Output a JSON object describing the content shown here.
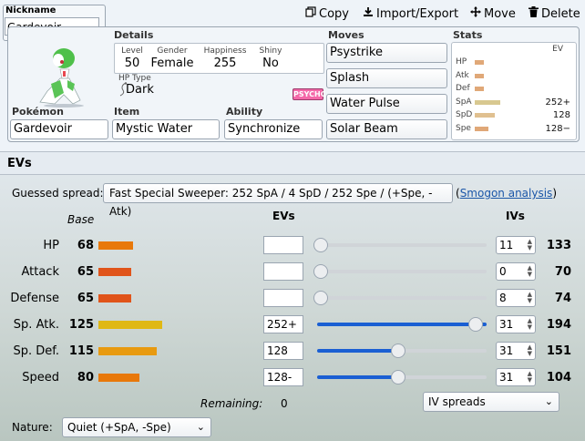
{
  "nickname": {
    "label": "Nickname",
    "value": "Gardevoir"
  },
  "toolbar": {
    "copy": "Copy",
    "import_export": "Import/Export",
    "move": "Move",
    "delete": "Delete"
  },
  "details": {
    "title": "Details",
    "level_label": "Level",
    "level": "50",
    "gender_label": "Gender",
    "gender": "Female",
    "happiness_label": "Happiness",
    "happiness": "255",
    "shiny_label": "Shiny",
    "shiny": "No",
    "hptype_label": "HP Type",
    "hptype": "Dark",
    "type_badge": "PSYCHC"
  },
  "pokemon": {
    "label": "Pokémon",
    "value": "Gardevoir"
  },
  "item": {
    "label": "Item",
    "value": "Mystic Water"
  },
  "ability": {
    "label": "Ability",
    "value": "Synchronize"
  },
  "moves": {
    "label": "Moves",
    "list": [
      "Psystrike",
      "Splash",
      "Water Pulse",
      "Solar Beam"
    ]
  },
  "stats": {
    "label": "Stats",
    "ev_header": "EV",
    "rows": [
      {
        "name": "HP",
        "ev": "",
        "bar": 0.13,
        "color": "#e0a878"
      },
      {
        "name": "Atk",
        "ev": "",
        "bar": 0.13,
        "color": "#e0a878"
      },
      {
        "name": "Def",
        "ev": "",
        "bar": 0.12,
        "color": "#e0a878"
      },
      {
        "name": "SpA",
        "ev": "252+",
        "bar": 0.35,
        "color": "#d8c890"
      },
      {
        "name": "SpD",
        "ev": "128",
        "bar": 0.28,
        "color": "#e0c090"
      },
      {
        "name": "Spe",
        "ev": "128−",
        "bar": 0.19,
        "color": "#e0a878"
      }
    ]
  },
  "ev_section": {
    "title": "EVs",
    "guessed_label": "Guessed spread:",
    "guessed_value": "Fast Special Sweeper: 252 SpA / 4 SpD / 252 Spe / (+Spe, -Atk)",
    "link_open": "(",
    "link_text": "Smogon analysis",
    "link_close": ")",
    "col_base": "Base",
    "col_evs": "EVs",
    "col_ivs": "IVs",
    "remaining_label": "Remaining:",
    "remaining_value": "0",
    "iv_spreads": "IV spreads",
    "nature_label": "Nature:",
    "nature_value": "Quiet (+SpA, -Spe)",
    "rows": [
      {
        "stat": "HP",
        "base": "68",
        "base_bar": 0.27,
        "bar_color": "#e8780a",
        "ev": "",
        "ev_fill": 0.0,
        "iv": "11",
        "total": "133"
      },
      {
        "stat": "Attack",
        "base": "65",
        "base_bar": 0.26,
        "bar_color": "#e0541a",
        "ev": "",
        "ev_fill": 0.0,
        "iv": "0",
        "total": "70"
      },
      {
        "stat": "Defense",
        "base": "65",
        "base_bar": 0.26,
        "bar_color": "#e0541a",
        "ev": "",
        "ev_fill": 0.0,
        "iv": "8",
        "total": "74"
      },
      {
        "stat": "Sp. Atk.",
        "base": "125",
        "base_bar": 0.5,
        "bar_color": "#e0b814",
        "ev": "252+",
        "ev_fill": 1.0,
        "iv": "31",
        "total": "194"
      },
      {
        "stat": "Sp. Def.",
        "base": "115",
        "base_bar": 0.46,
        "bar_color": "#e89a10",
        "ev": "128",
        "ev_fill": 0.5,
        "iv": "31",
        "total": "151"
      },
      {
        "stat": "Speed",
        "base": "80",
        "base_bar": 0.32,
        "bar_color": "#e8780a",
        "ev": "128-",
        "ev_fill": 0.5,
        "iv": "31",
        "total": "104"
      }
    ]
  },
  "icons": {
    "copy": "copy-icon",
    "import_export": "download-icon",
    "move": "move-arrows-icon",
    "delete": "trash-icon",
    "sprite": "gardevoir-sprite-icon"
  }
}
